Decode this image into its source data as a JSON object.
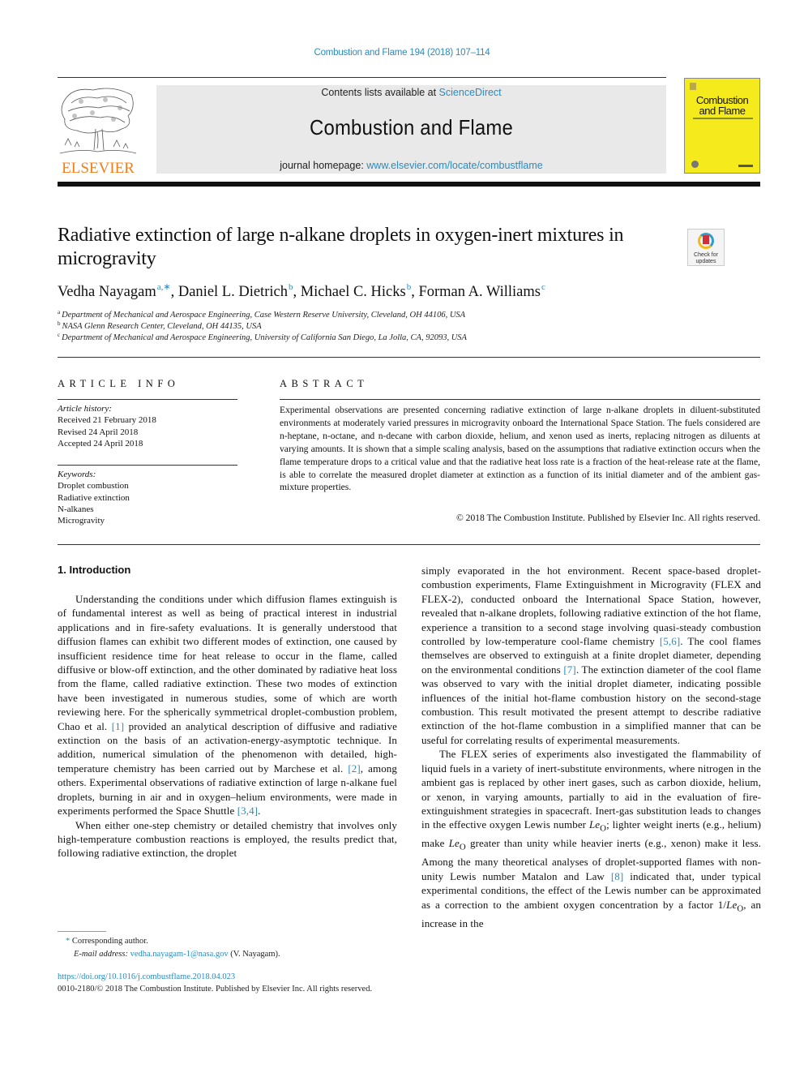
{
  "journal_ref": "Combustion and Flame 194 (2018) 107–114",
  "header": {
    "contents_prefix": "Contents lists available at ",
    "contents_link": "ScienceDirect",
    "journal_title": "Combustion and Flame",
    "homepage_prefix": "journal homepage: ",
    "homepage_link": "www.elsevier.com/locate/combustflame",
    "publisher_logo_text": "ELSEVIER",
    "cover_title_line1": "Combustion",
    "cover_title_line2": "and Flame",
    "crossmark_line1": "Check for",
    "crossmark_line2": "updates"
  },
  "article": {
    "title": "Radiative extinction of large n-alkane droplets in oxygen-inert mixtures in microgravity",
    "authors": [
      {
        "name": "Vedha Nayagam",
        "sup": "a,∗"
      },
      {
        "name": "Daniel L. Dietrich",
        "sup": "b"
      },
      {
        "name": "Michael C. Hicks",
        "sup": "b"
      },
      {
        "name": "Forman A. Williams",
        "sup": "c"
      }
    ],
    "affiliations": [
      {
        "mark": "a",
        "text": "Department of Mechanical and Aerospace Engineering, Case Western Reserve University, Cleveland, OH 44106, USA"
      },
      {
        "mark": "b",
        "text": "NASA Glenn Research Center, Cleveland, OH 44135, USA"
      },
      {
        "mark": "c",
        "text": "Department of Mechanical and Aerospace Engineering, University of California San Diego, La Jolla, CA, 92093, USA"
      }
    ]
  },
  "article_info": {
    "heading": "ARTICLE INFO",
    "history_label": "Article history:",
    "history": [
      "Received 21 February 2018",
      "Revised 24 April 2018",
      "Accepted 24 April 2018"
    ],
    "keywords_label": "Keywords:",
    "keywords": [
      "Droplet combustion",
      "Radiative extinction",
      "N-alkanes",
      "Microgravity"
    ]
  },
  "abstract": {
    "heading": "ABSTRACT",
    "text": "Experimental observations are presented concerning radiative extinction of large n-alkane droplets in diluent-substituted environments at moderately varied pressures in microgravity onboard the International Space Station. The fuels considered are n-heptane, n-octane, and n-decane with carbon dioxide, helium, and xenon used as inerts, replacing nitrogen as diluents at varying amounts. It is shown that a simple scaling analysis, based on the assumptions that radiative extinction occurs when the flame temperature drops to a critical value and that the radiative heat loss rate is a fraction of the heat-release rate at the flame, is able to correlate the measured droplet diameter at extinction as a function of its initial diameter and of the ambient gas-mixture properties.",
    "copyright": "© 2018 The Combustion Institute. Published by Elsevier Inc. All rights reserved."
  },
  "body": {
    "section_heading": "1. Introduction",
    "left": {
      "p1_a": "Understanding the conditions under which diffusion flames extinguish is of fundamental interest as well as being of practical interest in industrial applications and in fire-safety evaluations. It is generally understood that diffusion flames can exhibit two different modes of extinction, one caused by insufficient residence time for heat release to occur in the flame, called diffusive or blow-off extinction, and the other dominated by radiative heat loss from the flame, called radiative extinction. These two modes of extinction have been investigated in numerous studies, some of which are worth reviewing here. For the spherically symmetrical droplet-combustion problem, Chao et al. ",
      "ref1": "[1]",
      "p1_b": " provided an analytical description of diffusive and radiative extinction on the basis of an activation-energy-asymptotic technique. In addition, numerical simulation of the phenomenon with detailed, high-temperature chemistry has been carried out by Marchese et al. ",
      "ref2": "[2]",
      "p1_c": ", among others. Experimental observations of radiative extinction of large n-alkane fuel droplets, burning in air and in oxygen–helium environments, were made in experiments performed the Space Shuttle ",
      "ref3": "[3,4]",
      "p1_d": ".",
      "p2": "When either one-step chemistry or detailed chemistry that involves only high-temperature combustion reactions is employed, the results predict that, following radiative extinction, the droplet"
    },
    "right": {
      "p1_a": "simply evaporated in the hot environment. Recent space-based droplet-combustion experiments, Flame Extinguishment in Microgravity (FLEX and FLEX-2), conducted onboard the International Space Station, however, revealed that n-alkane droplets, following radiative extinction of the hot flame, experience a transition to a second stage involving quasi-steady combustion controlled by low-temperature cool-flame chemistry ",
      "ref56": "[5,6]",
      "p1_b": ". The cool flames themselves are observed to extinguish at a finite droplet diameter, depending on the environmental conditions ",
      "ref7": "[7]",
      "p1_c": ". The extinction diameter of the cool flame was observed to vary with the initial droplet diameter, indicating possible influences of the initial hot-flame combustion history on the second-stage combustion. This result motivated the present attempt to describe radiative extinction of the hot-flame combustion in a simplified manner that can be useful for correlating results of experimental measurements.",
      "p2_a": "The FLEX series of experiments also investigated the flammability of liquid fuels in a variety of inert-substitute environments, where nitrogen in the ambient gas is replaced by other inert gases, such as carbon dioxide, helium, or xenon, in varying amounts, partially to aid in the evaluation of fire-extinguishment strategies in spacecraft. Inert-gas substitution leads to changes in the effective oxygen Lewis number ",
      "le": "Le",
      "le_sub": "O",
      "p2_b": "; lighter weight inerts (e.g., helium) make ",
      "p2_c": " greater than unity while heavier inerts (e.g., xenon) make it less. Among the many theoretical analyses of droplet-supported flames with non-unity Lewis number Matalon and Law ",
      "ref8": "[8]",
      "p2_d": " indicated that, under typical experimental conditions, the effect of the Lewis number can be approximated as a correction to the ambient oxygen concentration by a factor 1/",
      "p2_e": ", an increase in the"
    }
  },
  "footnote": {
    "mark": "*",
    "corresponding": "Corresponding author.",
    "email_label": "E-mail address:",
    "email": "vedha.nayagam-1@nasa.gov",
    "email_owner": " (V. Nayagam)."
  },
  "doi": {
    "link": "https://doi.org/10.1016/j.combustflame.2018.04.023",
    "issn_line": "0010-2180/© 2018 The Combustion Institute. Published by Elsevier Inc. All rights reserved."
  },
  "colors": {
    "link": "#2a8bbf",
    "publisher_orange": "#f07f1b",
    "cover_yellow": "#f5ea1c",
    "header_gray": "#e9e9e9"
  }
}
